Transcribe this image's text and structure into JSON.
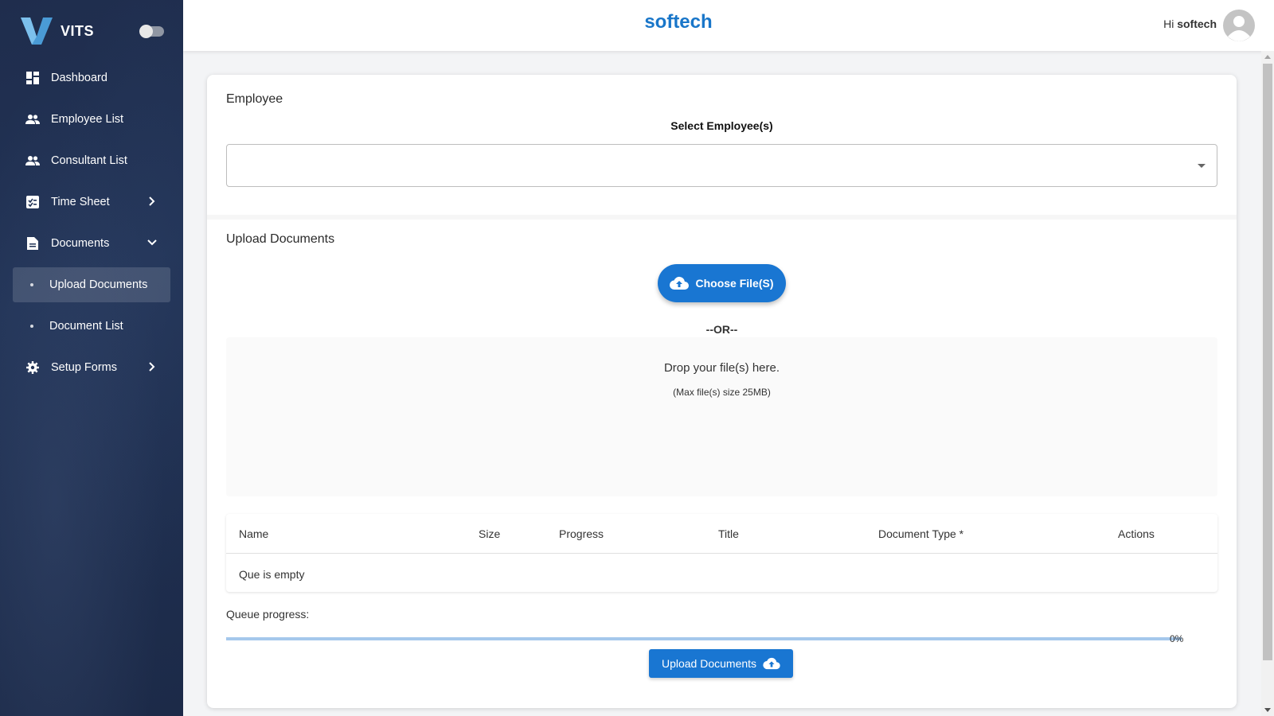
{
  "brand": {
    "name": "VITS",
    "logo_icon": "v-logo-icon"
  },
  "sidebar": {
    "items": [
      {
        "label": "Dashboard",
        "icon": "dashboard-icon"
      },
      {
        "label": "Employee List",
        "icon": "people-icon"
      },
      {
        "label": "Consultant List",
        "icon": "people-icon"
      },
      {
        "label": "Time Sheet",
        "icon": "timesheet-icon",
        "chevron": "right"
      },
      {
        "label": "Documents",
        "icon": "document-icon",
        "chevron": "down"
      },
      {
        "label": "Upload Documents",
        "active": true
      },
      {
        "label": "Document List"
      },
      {
        "label": "Setup Forms",
        "icon": "gear-icon",
        "chevron": "right"
      }
    ]
  },
  "header": {
    "title": "softech",
    "greeting_prefix": "Hi",
    "username": "softech"
  },
  "employee_section": {
    "title": "Employee",
    "select_label": "Select Employee(s)",
    "selected_value": ""
  },
  "upload_section": {
    "title": "Upload Documents",
    "choose_button": "Choose File(S)",
    "or_text": "--OR--",
    "drop_text": "Drop your file(s) here.",
    "drop_subtext": "(Max file(s) size 25MB)"
  },
  "table": {
    "columns": [
      "Name",
      "Size",
      "Progress",
      "Title",
      "Document Type *",
      "Actions"
    ],
    "empty_text": "Que is empty"
  },
  "queue": {
    "label": "Queue progress:",
    "progress_percent": 0,
    "progress_text": "0%"
  },
  "upload_button": {
    "label": "Upload Documents"
  },
  "colors": {
    "primary": "#1976d2",
    "sidebar_bg": "#1f2d4d",
    "title_color": "#1976c9"
  }
}
